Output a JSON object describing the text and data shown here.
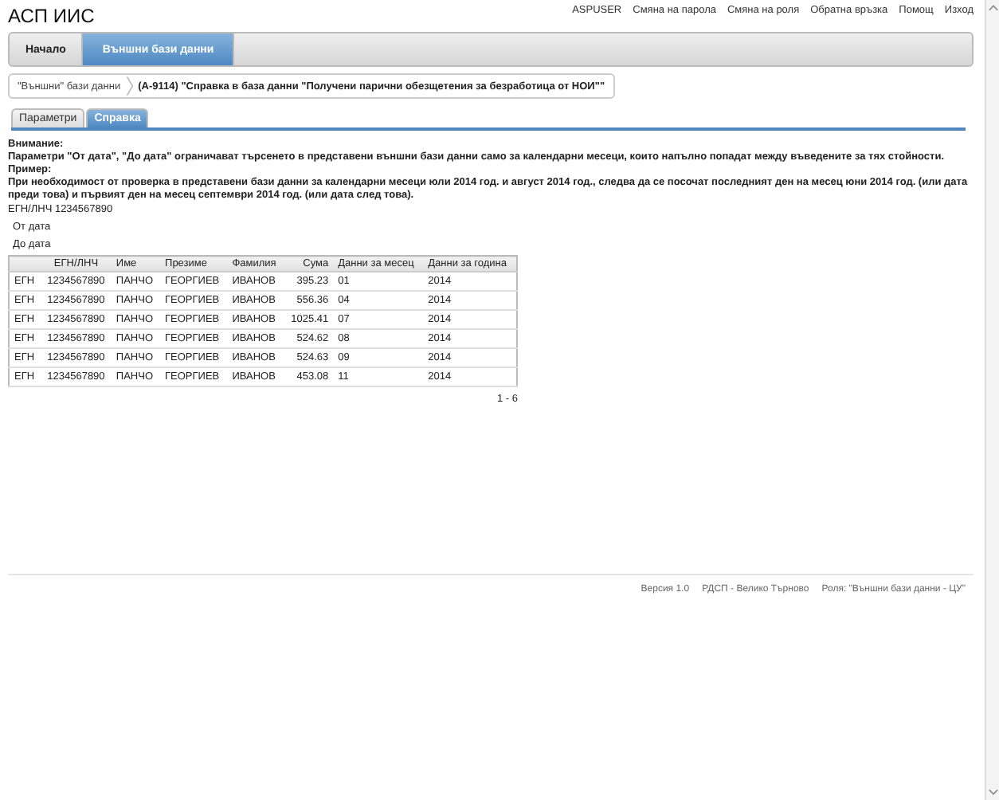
{
  "app_title": "АСП ИИС",
  "top_links": [
    "ASPUSER",
    "Смяна на парола",
    "Смяна на роля",
    "Обратна връзка",
    "Помощ",
    "Изход"
  ],
  "nav": [
    {
      "label": "Начало",
      "selected": false
    },
    {
      "label": "Външни бази данни",
      "selected": true
    }
  ],
  "breadcrumb": [
    "\"Външни\" бази данни",
    "(A-9114) \"Справка в база данни \"Получени парични обезщетения за безработица от НОИ\"\""
  ],
  "tabs": [
    {
      "label": "Параметри",
      "selected": false
    },
    {
      "label": "Справка",
      "selected": true
    }
  ],
  "notice": [
    "Внимание:",
    "Параметри \"От дата\", \"До дата\" ограничават търсенето в представени външни бази данни само за календарни месеци, които напълно попадат между въведените за тях стойности.",
    "Пример:",
    "При необходимост от проверка в представени бази данни за календарни месеци юли 2014 год. и август 2014 год., следва да се посочат последният ден на месец юни 2014 год. (или дата преди това) и първият ден на месец септември 2014 год. (или дата след това)."
  ],
  "params": [
    "ЕГН/ЛНЧ 1234567890",
    "От дата",
    "До дата"
  ],
  "table": {
    "columns": [
      "",
      "ЕГН/ЛНЧ",
      "Име",
      "Презиме",
      "Фамилия",
      "Сума",
      "Данни за месец",
      "Данни за година"
    ],
    "rows": [
      [
        "ЕГН",
        "1234567890",
        "ПАНЧО",
        "ГЕОРГИЕВ",
        "ИВАНОВ",
        "395.23",
        "01",
        "2014"
      ],
      [
        "ЕГН",
        "1234567890",
        "ПАНЧО",
        "ГЕОРГИЕВ",
        "ИВАНОВ",
        "556.36",
        "04",
        "2014"
      ],
      [
        "ЕГН",
        "1234567890",
        "ПАНЧО",
        "ГЕОРГИЕВ",
        "ИВАНОВ",
        "1025.41",
        "07",
        "2014"
      ],
      [
        "ЕГН",
        "1234567890",
        "ПАНЧО",
        "ГЕОРГИЕВ",
        "ИВАНОВ",
        "524.62",
        "08",
        "2014"
      ],
      [
        "ЕГН",
        "1234567890",
        "ПАНЧО",
        "ГЕОРГИЕВ",
        "ИВАНОВ",
        "524.63",
        "09",
        "2014"
      ],
      [
        "ЕГН",
        "1234567890",
        "ПАНЧО",
        "ГЕОРГИЕВ",
        "ИВАНОВ",
        "453.08",
        "11",
        "2014"
      ]
    ]
  },
  "pager": "1 - 6",
  "footer": [
    "Версия 1.0",
    "РДСП - Велико Търново",
    "Роля: \"Външни бази данни - ЦУ\""
  ]
}
